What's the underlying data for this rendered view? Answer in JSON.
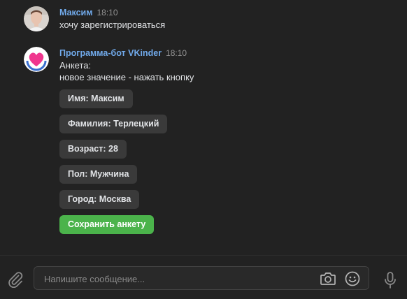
{
  "messages": [
    {
      "author": "Максим",
      "time": "18:10",
      "lines": [
        "хочу зарегистрироваться"
      ],
      "avatar": "user-photo-avatar"
    },
    {
      "author": "Программа-бот VKinder",
      "time": "18:10",
      "lines": [
        "Анкета:",
        "новое значение - нажать кнопку"
      ],
      "avatar": "heart-logo-avatar"
    }
  ],
  "keyboard": {
    "buttons": [
      {
        "label": "Имя: Максим"
      },
      {
        "label": "Фамилия: Терлецкий"
      },
      {
        "label": "Возраст: 28"
      },
      {
        "label": "Пол: Мужчина"
      },
      {
        "label": "Город: Москва"
      },
      {
        "label": "Сохранить анкету",
        "color": "#4bb34b"
      }
    ]
  },
  "composer": {
    "placeholder": "Напишите сообщение...",
    "icons": [
      "paperclip-icon",
      "camera-icon",
      "smile-icon",
      "microphone-icon"
    ]
  },
  "colors": {
    "background": "#222222",
    "author_link": "#71aaeb",
    "button_bg": "#3a3a3a",
    "primary_button": "#4bb34b"
  }
}
